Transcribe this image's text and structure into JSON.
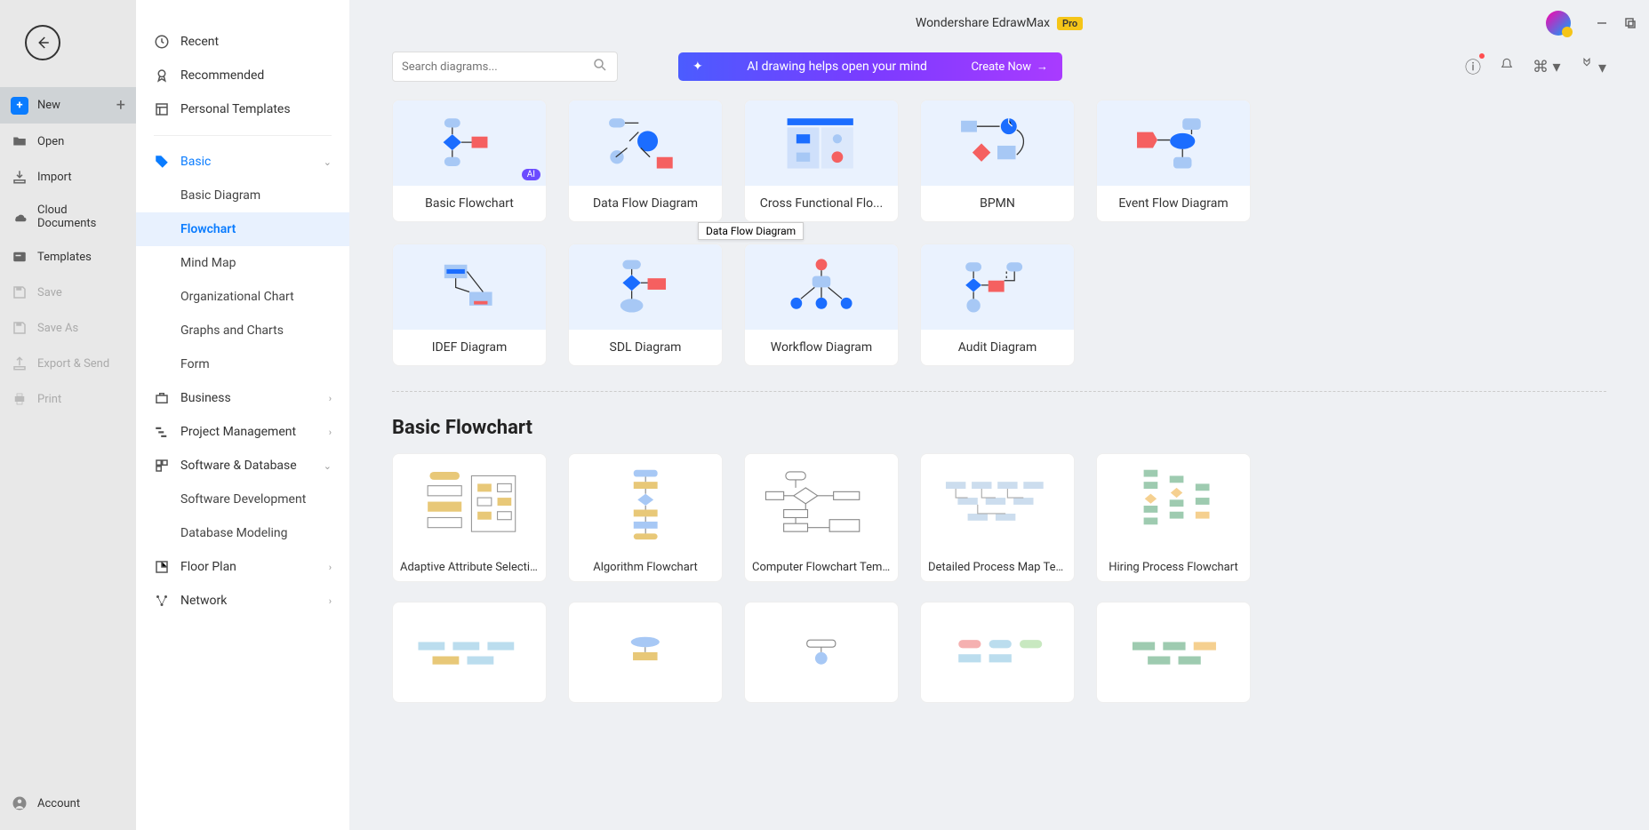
{
  "app": {
    "title": "Wondershare EdrawMax",
    "badge": "Pro"
  },
  "leftSidebar": {
    "new": "New",
    "open": "Open",
    "import": "Import",
    "cloud": "Cloud Documents",
    "templates": "Templates",
    "save": "Save",
    "saveAs": "Save As",
    "exportSend": "Export & Send",
    "print": "Print",
    "account": "Account"
  },
  "catSidebar": {
    "recent": "Recent",
    "recommended": "Recommended",
    "personal": "Personal Templates",
    "basic": {
      "label": "Basic",
      "items": [
        "Basic Diagram",
        "Flowchart",
        "Mind Map",
        "Organizational Chart",
        "Graphs and Charts",
        "Form"
      ],
      "selected": "Flowchart"
    },
    "business": "Business",
    "project": "Project Management",
    "software": {
      "label": "Software & Database",
      "items": [
        "Software Development",
        "Database Modeling"
      ]
    },
    "floorPlan": "Floor Plan",
    "network": "Network"
  },
  "search": {
    "placeholder": "Search diagrams..."
  },
  "aiBanner": {
    "text": "AI drawing helps open your mind",
    "cta": "Create Now"
  },
  "diagramTypes": [
    "Basic Flowchart",
    "Data Flow Diagram",
    "Cross Functional Flo...",
    "BPMN",
    "Event Flow Diagram",
    "IDEF Diagram",
    "SDL Diagram",
    "Workflow Diagram",
    "Audit Diagram"
  ],
  "tooltip": "Data Flow Diagram",
  "sectionTitle": "Basic Flowchart",
  "templates": [
    "Adaptive Attribute Selecti...",
    "Algorithm Flowchart",
    "Computer Flowchart Temp...",
    "Detailed Process Map Tem...",
    "Hiring Process Flowchart"
  ]
}
